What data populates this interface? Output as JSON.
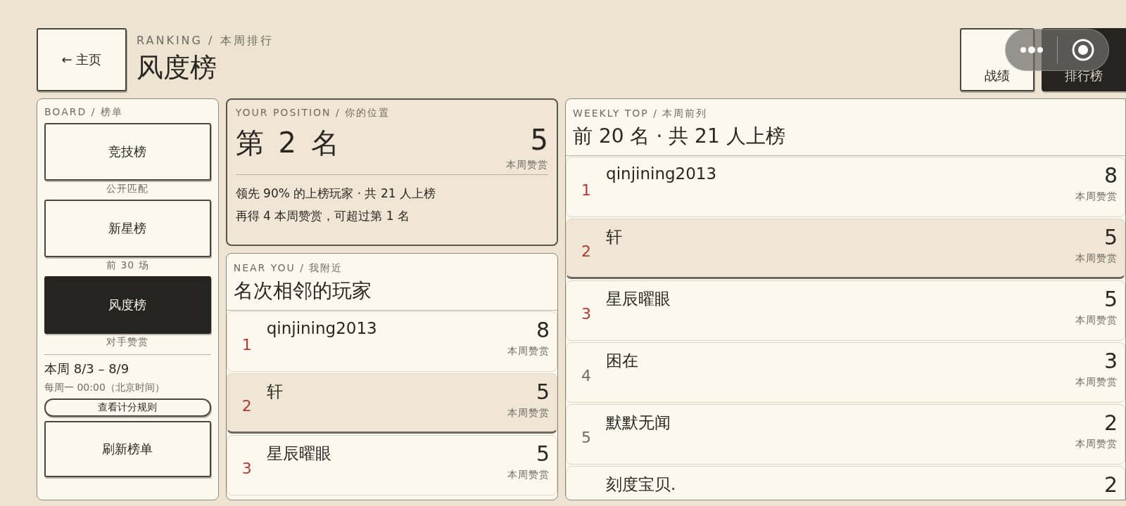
{
  "header": {
    "back_button": "← 主页",
    "eyebrow": "RANKING / 本周排行",
    "title": "风度榜",
    "nav": [
      {
        "label": "战绩",
        "selected": false
      },
      {
        "label": "排行榜",
        "selected": true
      }
    ]
  },
  "board": {
    "label": "BOARD / 榜单",
    "items": [
      {
        "name": "竞技榜",
        "caption": "公开匹配",
        "selected": false
      },
      {
        "name": "新星榜",
        "caption": "前 30 场",
        "selected": false
      },
      {
        "name": "风度榜",
        "caption": "对手赞赏",
        "selected": true
      }
    ],
    "week": "本周 8/3 – 8/9",
    "reset": "每周一 00:00（北京时间）",
    "rules_button": "查看计分规则",
    "refresh_button": "刷新榜单"
  },
  "position": {
    "eyebrow": "YOUR POSITION / 你的位置",
    "rank": "第 2 名",
    "score": "5",
    "score_label": "本周赞赏",
    "lead": "领先 90% 的上榜玩家 · 共 21 人上榜",
    "hint": "再得 4 本周赞赏，可超过第 1 名"
  },
  "near": {
    "eyebrow": "NEAR YOU / 我附近",
    "title": "名次相邻的玩家",
    "rows": [
      {
        "kind": "full",
        "rank": "1",
        "podium": true,
        "name": "qinjining2013",
        "score": "8",
        "score_label": "本周赞赏",
        "selected": false
      },
      {
        "kind": "full",
        "rank": "2",
        "podium": true,
        "name": "轩",
        "score": "5",
        "score_label": "本周赞赏",
        "selected": true
      },
      {
        "kind": "full",
        "rank": "3",
        "podium": true,
        "name": "星辰曜眼",
        "score": "5",
        "score_label": "本周赞赏",
        "selected": false
      }
    ]
  },
  "weekly": {
    "eyebrow": "WEEKLY TOP / 本周前列",
    "title": "前 20 名 · 共 21 人上榜",
    "rows": [
      {
        "kind": "full",
        "rank": "1",
        "podium": true,
        "name": "qinjining2013",
        "score": "8",
        "score_label": "本周赞赏",
        "selected": false
      },
      {
        "kind": "full",
        "rank": "2",
        "podium": true,
        "name": "轩",
        "score": "5",
        "score_label": "本周赞赏",
        "selected": true
      },
      {
        "kind": "full",
        "rank": "3",
        "podium": true,
        "name": "星辰曜眼",
        "score": "5",
        "score_label": "本周赞赏",
        "selected": false
      },
      {
        "kind": "full",
        "rank": "4",
        "podium": false,
        "name": "困在",
        "score": "3",
        "score_label": "本周赞赏",
        "selected": false
      },
      {
        "kind": "full",
        "rank": "5",
        "podium": false,
        "name": "默默无闻",
        "score": "2",
        "score_label": "本周赞赏",
        "selected": false
      },
      {
        "kind": "cut",
        "name": "刻度宝贝.",
        "score": "2",
        "selected": false
      }
    ]
  }
}
